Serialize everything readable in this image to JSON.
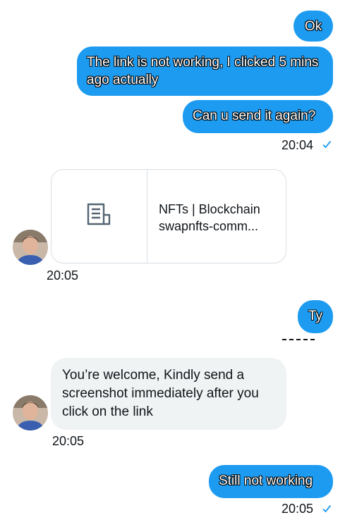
{
  "messages": {
    "m1": {
      "text": "Ok"
    },
    "m2": {
      "text": "The link is not working, I clicked 5 mins ago actually"
    },
    "m3": {
      "text": "Can u send it again?",
      "time": "20:04"
    },
    "m4": {
      "link_title": "NFTs | Blockchain",
      "link_url": "swapnfts-comm...",
      "time": "20:05"
    },
    "m5": {
      "text": "Ty"
    },
    "m6": {
      "text": "You’re welcome, Kindly send a screenshot immediately after you click on the link",
      "time": "20:05"
    },
    "m7": {
      "text": "Still not working",
      "time": "20:05"
    }
  },
  "icons": {
    "read_receipt": "check-icon",
    "link_placeholder": "document-icon"
  },
  "colors": {
    "outgoing_bubble": "#1d9bf0",
    "incoming_bubble": "#eff3f4",
    "check": "#1d9bf0"
  }
}
